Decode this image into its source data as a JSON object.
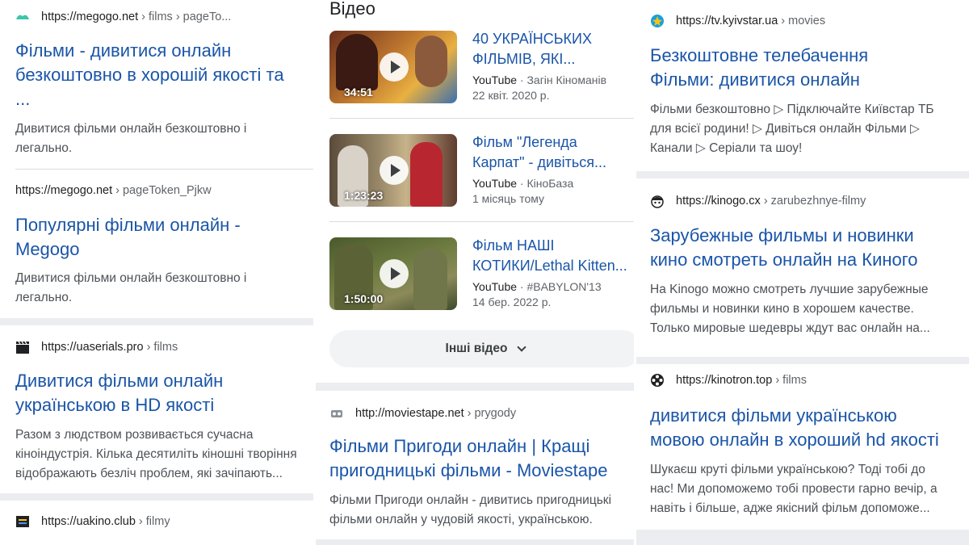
{
  "col1": {
    "r1": {
      "site": "https://megogo.net",
      "crumb": "› films › pageTo...",
      "title": [
        "Фільми - дивитися онлайн",
        "безкоштовно в хорошій якості та",
        "..."
      ],
      "snippet": [
        "Дивитися фільми онлайн безкоштовно і",
        "легально."
      ]
    },
    "r2": {
      "site": "https://megogo.net",
      "crumb": "› pageToken_Pjkw",
      "title": [
        "Популярні фільми онлайн -",
        "Megogo"
      ],
      "snippet": [
        "Дивитися фільми онлайн безкоштовно і",
        "легально."
      ]
    },
    "r3": {
      "site": "https://uaserials.pro",
      "crumb": "› films",
      "title": [
        "Дивитися фільми онлайн",
        "українською в HD якості"
      ],
      "snippet": [
        "Разом з людством розвивається сучасна",
        "кіноіндустрія. Кілька десятиліть кіношні творіння",
        "відображають безліч проблем, які зачіпають..."
      ]
    },
    "r4": {
      "site": "https://uakino.club",
      "crumb": "› filmy"
    }
  },
  "col2": {
    "heading": "Відео",
    "videos": [
      {
        "title": [
          "40 УКРАЇНСЬКИХ",
          "ФІЛЬМІВ, ЯКІ..."
        ],
        "source": "YouTube",
        "channel": "· Загін Кіноманів",
        "date": "22 квіт. 2020 р.",
        "duration": "34:51"
      },
      {
        "title": [
          "Фільм \"Легенда",
          "Карпат\" - дивіться..."
        ],
        "source": "YouTube",
        "channel": "· КіноБаза",
        "date": "1 місяць тому",
        "duration": "1:23:23"
      },
      {
        "title": [
          "Фільм НАШІ",
          "КОТИКИ/Lethal Kitten..."
        ],
        "source": "YouTube",
        "channel": "· #BABYLON'13",
        "date": "14 бер. 2022 р.",
        "duration": "1:50:00"
      }
    ],
    "more_label": "Інші відео",
    "r5": {
      "site": "http://moviestape.net",
      "crumb": "› prygody",
      "title": [
        "Фільми Пригоди онлайн | Кращі",
        "пригодницькі фільми - Moviestape"
      ],
      "snippet": [
        "Фільми Пригоди онлайн - дивитись пригодницькі",
        "фільми онлайн у чудовій якості, українською."
      ]
    }
  },
  "col3": {
    "r6": {
      "site": "https://tv.kyivstar.ua",
      "crumb": "› movies",
      "title": [
        "Безкоштовне телебачення",
        "Фільми: дивитися онлайн"
      ],
      "snippet": [
        "Фільми безкоштовно ▷ Підключайте Київстар ТБ",
        "для всієї родини! ▷ Дивіться онлайн Фільми ▷",
        "Канали ▷ Серіали та шоу!"
      ]
    },
    "r7": {
      "site": "https://kinogo.cx",
      "crumb": "› zarubezhnye-filmy",
      "title": [
        "Зарубежные фильмы и новинки",
        "кино смотреть онлайн на Киного"
      ],
      "snippet": [
        "На Kinogo можно смотреть лучшие зарубежные",
        "фильмы и новинки кино в хорошем качестве.",
        "Только мировые шедевры ждут вас онлайн на..."
      ]
    },
    "r8": {
      "site": "https://kinotron.top",
      "crumb": "› films",
      "title": [
        "дивитися фільми українською",
        "мовою онлайн в хороший hd якості"
      ],
      "snippet": [
        "Шукаєш круті фільми українською? Тоді тобі до",
        "нас! Ми допоможемо тобі провести гарно вечір, а",
        "навіть і більше, адже якісний фільм допоможе..."
      ]
    }
  },
  "colors": {
    "link": "#1a55a8",
    "snippet": "#4d5156",
    "separator": "#ebedf0"
  }
}
